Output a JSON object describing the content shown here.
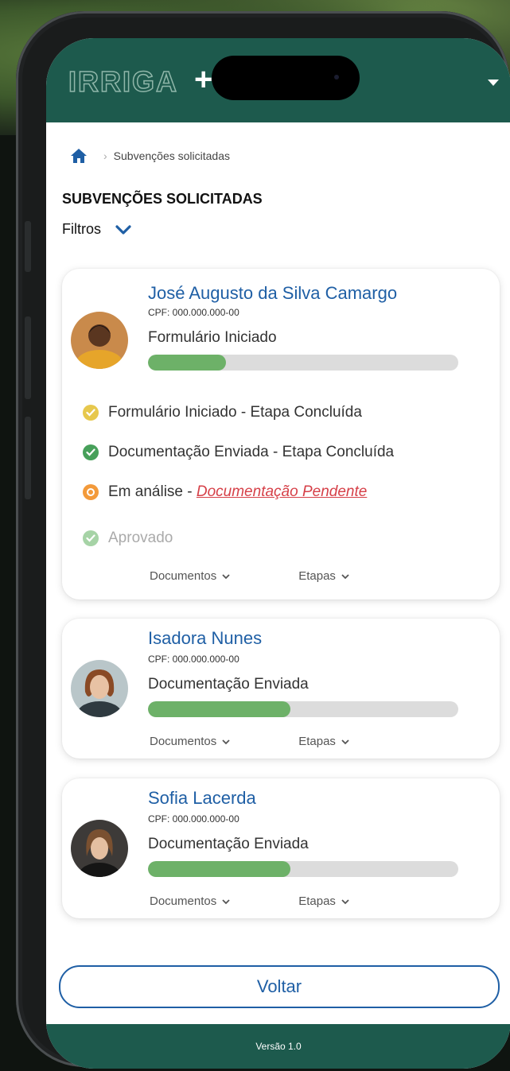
{
  "app": {
    "logo_text": "IRRIGA",
    "logo_plus": "+"
  },
  "breadcrumb": {
    "current": "Subvenções solicitadas"
  },
  "page": {
    "title": "SUBVENÇÕES SOLICITADAS",
    "filters_label": "Filtros"
  },
  "cards": [
    {
      "name": "José Augusto da Silva Camargo",
      "cpf": "CPF: 000.000.000-00",
      "status": "Formulário Iniciado",
      "progress": 0.25,
      "steps": [
        {
          "text": "Formulário Iniciado - Etapa Concluída",
          "color": "#e7c84d",
          "state": "done"
        },
        {
          "text": "Documentação Enviada - Etapa Concluída",
          "color": "#47a05a",
          "state": "done"
        },
        {
          "text_prefix": "Em análise - ",
          "link": "Documentação Pendente",
          "color": "#f39a3a",
          "state": "pending"
        },
        {
          "text": "Aprovado",
          "color": "#a6d3a6",
          "state": "future"
        }
      ],
      "links": {
        "documents": "Documentos",
        "steps": "Etapas"
      }
    },
    {
      "name": "Isadora Nunes",
      "cpf": "CPF: 000.000.000-00",
      "status": "Documentação Enviada",
      "progress": 0.46,
      "links": {
        "documents": "Documentos",
        "steps": "Etapas"
      }
    },
    {
      "name": "Sofia Lacerda",
      "cpf": "CPF: 000.000.000-00",
      "status": "Documentação Enviada",
      "progress": 0.46,
      "links": {
        "documents": "Documentos",
        "steps": "Etapas"
      }
    }
  ],
  "back_button": "Voltar",
  "footer": {
    "version": "Versão 1.0"
  },
  "colors": {
    "brand": "#1d5a4d",
    "accent": "#1f5fa5",
    "progress": "#6db168"
  }
}
